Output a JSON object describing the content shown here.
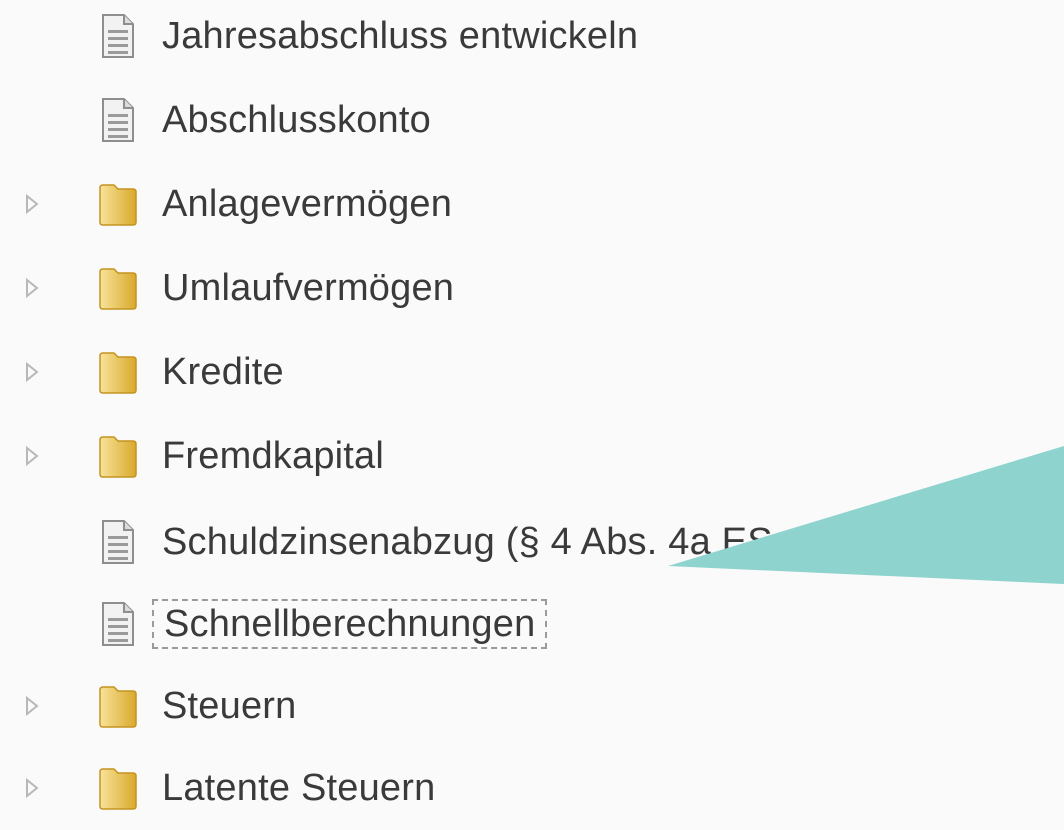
{
  "tree": {
    "items": [
      {
        "label": "Jahresabschluss entwickeln",
        "type": "document",
        "icon": "document-icon",
        "expandable": false
      },
      {
        "label": "Abschlusskonto",
        "type": "document",
        "icon": "document-icon",
        "expandable": false
      },
      {
        "label": "Anlagevermögen",
        "type": "folder",
        "icon": "folder-icon",
        "expandable": true
      },
      {
        "label": "Umlaufvermögen",
        "type": "folder",
        "icon": "folder-icon",
        "expandable": true
      },
      {
        "label": "Kredite",
        "type": "folder",
        "icon": "folder-icon",
        "expandable": true
      },
      {
        "label": "Fremdkapital",
        "type": "folder",
        "icon": "folder-icon",
        "expandable": true
      },
      {
        "label": "Schuldzinsenabzug (§ 4 Abs. 4a ES",
        "type": "document",
        "icon": "document-icon",
        "expandable": false
      },
      {
        "label": "Schnellberechnungen",
        "type": "document",
        "icon": "document-icon",
        "expandable": false,
        "focused": true
      },
      {
        "label": "Steuern",
        "type": "folder",
        "icon": "folder-icon",
        "expandable": true
      },
      {
        "label": "Latente Steuern",
        "type": "folder",
        "icon": "folder-icon",
        "expandable": true
      }
    ]
  },
  "colors": {
    "background": "#fafafa",
    "text": "#3a3a3a",
    "callout": "#8fd3cf",
    "folder_light": "#f6dc8a",
    "folder_dark": "#d9a92b",
    "expander": "#b8b8b8"
  }
}
